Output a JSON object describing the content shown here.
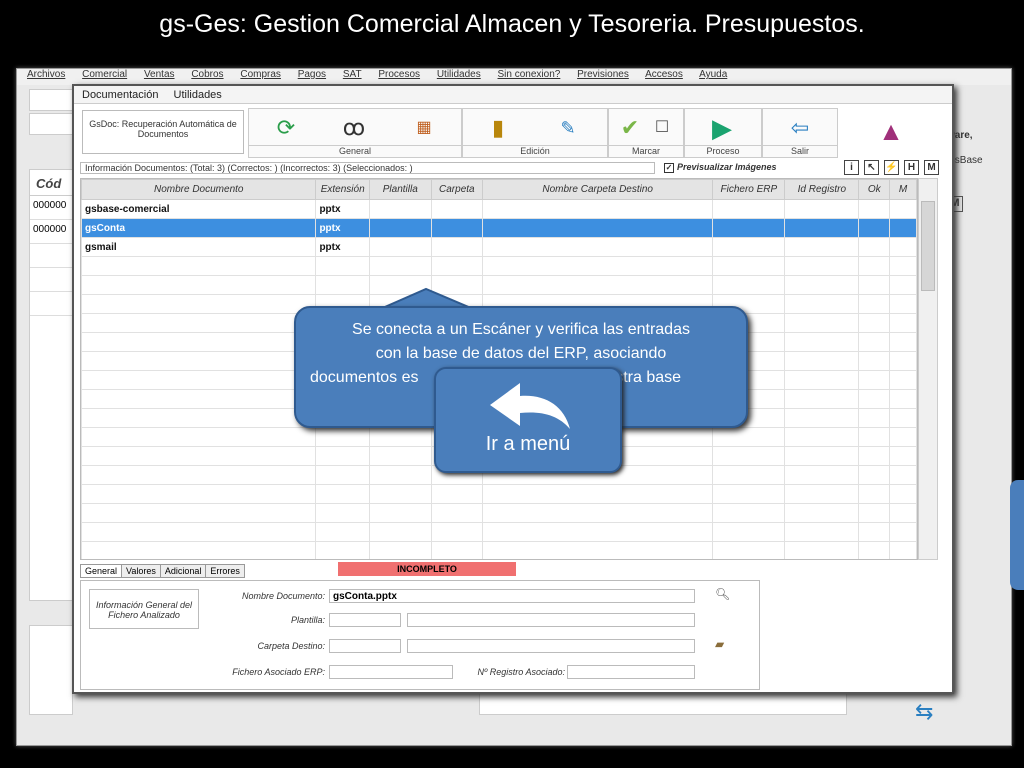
{
  "slide_title": "gs-Ges: Gestion Comercial Almacen y Tesoreria. Presupuestos.",
  "background_app": {
    "menu": [
      "Archivos",
      "Comercial",
      "Ventas",
      "Cobros",
      "Compras",
      "Pagos",
      "SAT",
      "Procesos",
      "Utilidades",
      "Sin conexion?",
      "Previsiones",
      "Accesos",
      "Ayuda"
    ],
    "left_header": "Cód",
    "left_cells": [
      "000000",
      "000000"
    ],
    "right_text_1": "a",
    "right_text_2": "ware,",
    "right_text_3": "GsBase",
    "right_button": "M"
  },
  "window": {
    "menu": [
      "Documentación",
      "Utilidades"
    ],
    "tool_description": "GsDoc: Recuperación Automática de Documentos",
    "groups": [
      {
        "label": "General",
        "icons": [
          "refresh-icon",
          "glasses-icon",
          "grid-settings-icon"
        ]
      },
      {
        "label": "Edición",
        "icons": [
          "folder-add-icon",
          "edit-icon"
        ]
      },
      {
        "label": "Marcar",
        "icons": [
          "checkmark-icon",
          "checkbox-icon"
        ]
      },
      {
        "label": "Proceso",
        "icons": [
          "play-icon"
        ]
      },
      {
        "label": "Salir",
        "icons": [
          "exit-user-icon"
        ]
      }
    ],
    "info_text": "Información Documentos: (Total: 3) (Correctos: ) (Incorrectos: 3) (Seleccionados: )",
    "preview_label": "Previsualizar Imágenes",
    "preview_checked": true,
    "small_buttons": [
      "i",
      "↖",
      "⚡",
      "H",
      "M"
    ],
    "columns": [
      "Nombre Documento",
      "Extensión",
      "Plantilla",
      "Carpeta",
      "Nombre Carpeta Destino",
      "Fichero ERP",
      "Id Registro",
      "Ok",
      "M"
    ],
    "rows": [
      {
        "nombre": "gsbase-comercial",
        "extension": "pptx",
        "selected": false
      },
      {
        "nombre": "gsConta",
        "extension": "pptx",
        "selected": true
      },
      {
        "nombre": "gsmail",
        "extension": "pptx",
        "selected": false
      }
    ],
    "tabs": [
      "General",
      "Valores",
      "Adicional",
      "Errores"
    ],
    "status": "INCOMPLETO",
    "form": {
      "description": "Información General del Fichero Analizado",
      "nombre_label": "Nombre Documento:",
      "nombre_value": "gsConta.pptx",
      "plantilla_label": "Plantilla:",
      "carpeta_label": "Carpeta Destino:",
      "fichero_label": "Fichero Asociado ERP:",
      "registro_label": "Nº Registro Asociado:"
    }
  },
  "callout": {
    "line1": "Se conecta a un Escáner y verifica las entradas",
    "line2": "con la base de datos del ERP, asociando",
    "line3": "documentos es",
    "line3_end": "nuestra base"
  },
  "menu_button": {
    "label": "Ir a menú",
    "color": "#4a7ebb"
  }
}
